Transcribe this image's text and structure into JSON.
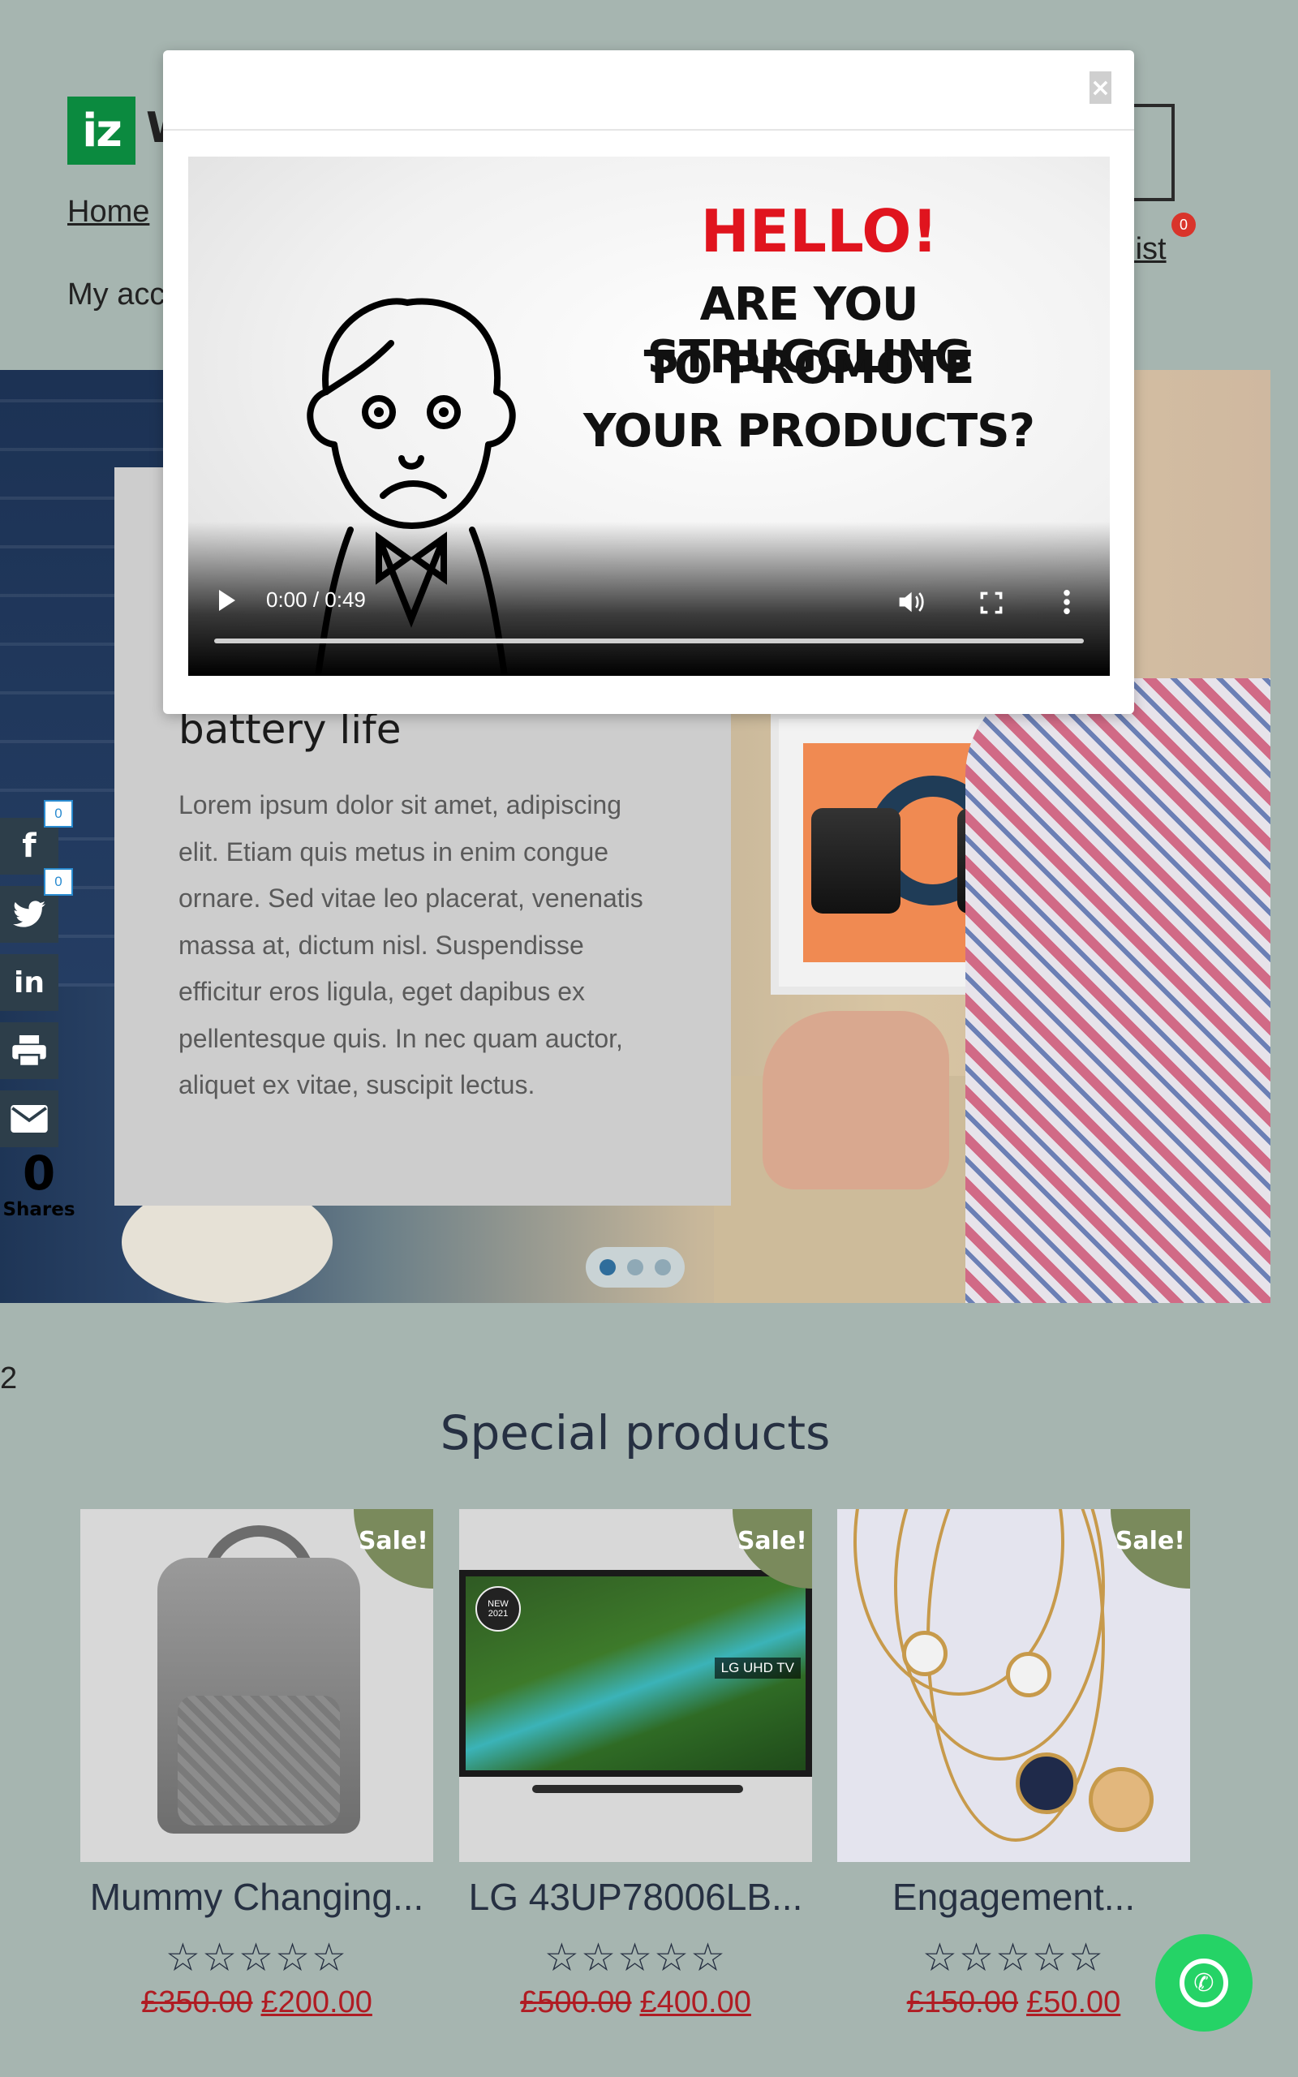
{
  "header": {
    "logo_text": "iz",
    "logo_trailing": "W",
    "nav_home": "Home",
    "nav_account": "My acc",
    "nav_wishlist": "nlist",
    "wishlist_count": "0"
  },
  "hero": {
    "title": "battery life",
    "body": "Lorem ipsum dolor sit amet, adipiscing elit. Etiam quis metus in enim congue ornare. Sed vitae leo placerat, venenatis massa at, dictum nisl. Suspendisse efficitur eros ligula, eget dapibus ex pellentesque quis. In nec quam auctor, aliquet ex vitae, suscipit lectus.",
    "slides": 3,
    "active_slide": 1
  },
  "social": {
    "facebook_count": "0",
    "twitter_count": "0",
    "shares_number": "0",
    "shares_label": "Shares",
    "icons": [
      "facebook-icon",
      "twitter-icon",
      "linkedin-icon",
      "print-icon",
      "email-icon"
    ]
  },
  "products": {
    "stray_text": "2",
    "section_title": "Special products",
    "items": [
      {
        "name": "Mummy Changing...",
        "sale_label": "Sale!",
        "old_price": "£350.00",
        "new_price": "£200.00",
        "rating": 0
      },
      {
        "name": "LG 43UP78006LB...",
        "sale_label": "Sale!",
        "old_price": "£500.00",
        "new_price": "£400.00",
        "rating": 0,
        "tv_badge": "NEW 2021",
        "tv_tag": "LG UHD TV"
      },
      {
        "name": "Engagement...",
        "sale_label": "Sale!",
        "old_price": "£150.00",
        "new_price": "£50.00",
        "rating": 0
      }
    ]
  },
  "modal": {
    "close_glyph": "×",
    "video": {
      "line1": "HELLO!",
      "line2": "ARE YOU STRUGGLING",
      "line3": "TO PROMOTE",
      "line4": "YOUR PRODUCTS?",
      "time": "0:00 / 0:49",
      "progress": 0
    }
  },
  "colors": {
    "page_bg": "#a6b5b0",
    "sale_badge": "#7a8a5c",
    "price_red": "#b01c23",
    "whatsapp": "#25d366",
    "hello_red": "#e0141e"
  }
}
